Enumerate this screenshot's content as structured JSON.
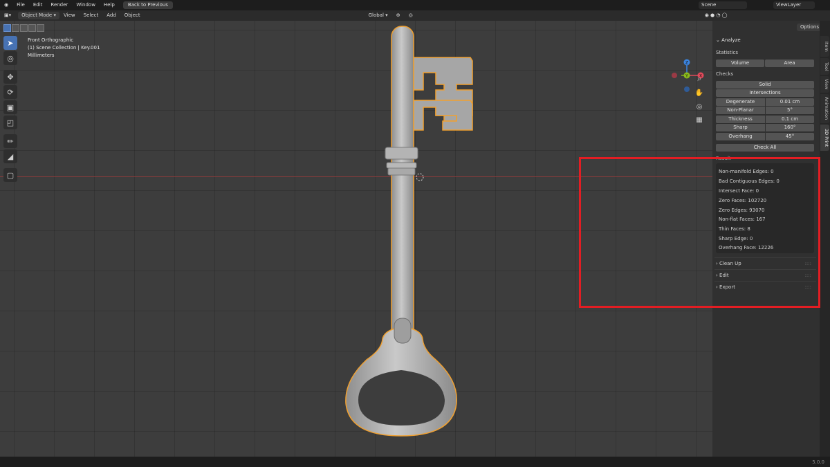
{
  "topbar": {
    "menus": [
      "File",
      "Edit",
      "Render",
      "Window",
      "Help"
    ],
    "back_button": "Back to Previous",
    "scene": "Scene",
    "view_layer": "ViewLayer"
  },
  "viewport_header": {
    "mode": "Object Mode",
    "menus": [
      "View",
      "Select",
      "Add",
      "Object"
    ],
    "orientation": "Global"
  },
  "overlay": {
    "view_name": "Front Orthographic",
    "collection": "(1) Scene Collection | Key.001",
    "units": "Millimeters"
  },
  "gizmo": {
    "z": "Z",
    "y": "Y",
    "x": "X"
  },
  "sidebar": {
    "options_label": "Options",
    "tabs": [
      "Item",
      "Tool",
      "View",
      "Animation",
      "3D Print"
    ],
    "active_tab": "3D Print",
    "analyze": {
      "title": "Analyze",
      "statistics_label": "Statistics",
      "volume_button": "Volume",
      "area_button": "Area",
      "checks_label": "Checks",
      "solid_button": "Solid",
      "intersections_button": "Intersections",
      "checks": [
        {
          "name": "Degenerate",
          "value": "0.01 cm"
        },
        {
          "name": "Non-Planar",
          "value": "5°"
        },
        {
          "name": "Thickness",
          "value": "0.1 cm"
        },
        {
          "name": "Sharp",
          "value": "160°"
        },
        {
          "name": "Overhang",
          "value": "45°"
        }
      ],
      "check_all_button": "Check All"
    },
    "result": {
      "title": "Result",
      "lines": [
        "Non-manifold Edges: 0",
        "Bad Contiguous Edges: 0",
        "Intersect Face: 0",
        "Zero Faces: 102720",
        "Zero Edges: 93070",
        "Non-flat Faces: 167",
        "Thin Faces: 8",
        "Sharp Edge: 0",
        "Overhang Face: 12226"
      ]
    },
    "subpanels": [
      "Clean Up",
      "Edit",
      "Export"
    ]
  },
  "status": {
    "version": "5.0.0"
  },
  "colors": {
    "highlight": "#e31d23",
    "selection_outline": "#f0a030",
    "accent": "#4772b3",
    "axis_x": "#e24a5b",
    "axis_y": "#8bbb1b",
    "axis_z": "#3b84e0"
  }
}
